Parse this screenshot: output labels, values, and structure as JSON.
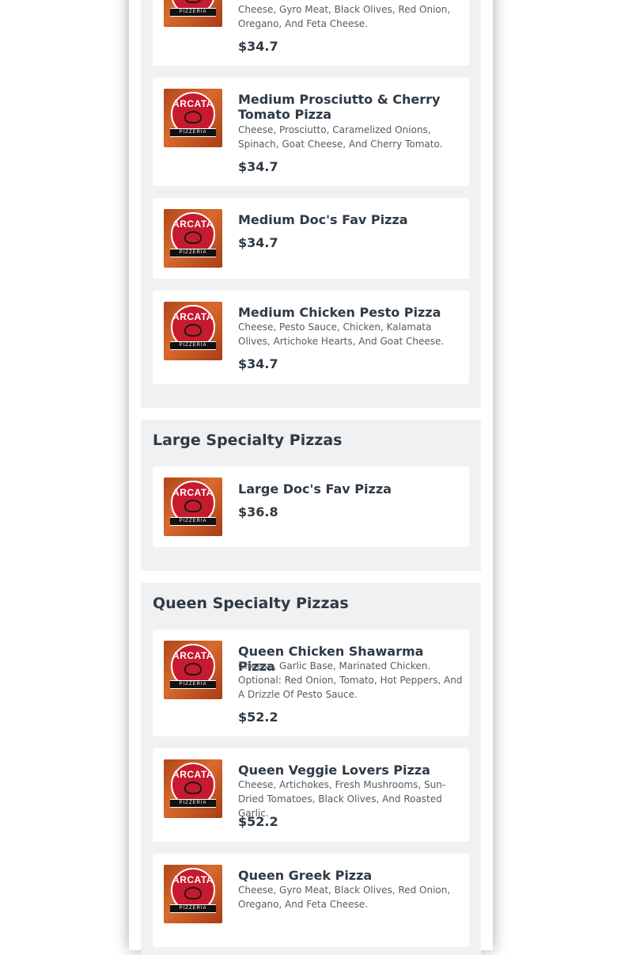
{
  "brand": {
    "logo_text": "ARCATA",
    "logo_sub": "PIZZERIA"
  },
  "medium_items": [
    {
      "name": "",
      "description": "Cheese, Gyro Meat, Black Olives, Red Onion, Oregano, And Feta Cheese.",
      "price": "$34.7"
    },
    {
      "name": "Medium Prosciutto & Cherry Tomato Pizza",
      "description": "Cheese, Prosciutto, Caramelized Onions, Spinach, Goat Cheese, And Cherry Tomato.",
      "price": "$34.7"
    },
    {
      "name": "Medium Doc's Fav Pizza",
      "description": "",
      "price": "$34.7"
    },
    {
      "name": "Medium Chicken Pesto Pizza",
      "description": "Cheese, Pesto Sauce, Chicken, Kalamata Olives, Artichoke Hearts, And Goat Cheese.",
      "price": "$34.7"
    }
  ],
  "large_section": {
    "title": "Large Specialty Pizzas",
    "items": [
      {
        "name": "Large Doc's Fav Pizza",
        "price": "$36.8"
      }
    ]
  },
  "queen_section": {
    "title": "Queen Specialty Pizzas",
    "items": [
      {
        "name": "Queen Chicken Shawarma Pizza",
        "description": "Cheese, Garlic Base, Marinated Chicken. Optional: Red Onion, Tomato, Hot Peppers, And A Drizzle Of Pesto Sauce.",
        "price": "$52.2"
      },
      {
        "name": "Queen Veggie Lovers Pizza",
        "description": "Cheese, Artichokes, Fresh Mushrooms, Sun-Dried Tomatoes, Black Olives, And Roasted Garlic.",
        "price": "$52.2"
      },
      {
        "name": "Queen Greek Pizza",
        "description": "Cheese, Gyro Meat, Black Olives, Red Onion, Oregano, And Feta Cheese.",
        "price": ""
      }
    ]
  },
  "colors": {
    "accent": "#c71a2e",
    "section_bg": "#f0f1f2",
    "text": "#2f3a44"
  }
}
